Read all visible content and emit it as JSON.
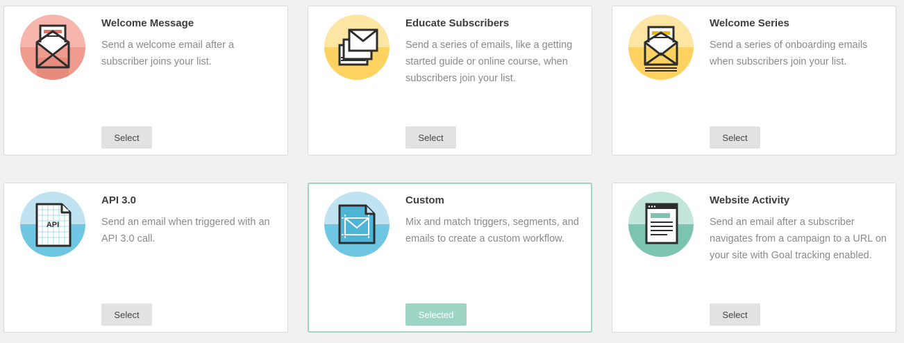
{
  "cards": [
    {
      "title": "Welcome Message",
      "desc": "Send a welcome email after a subscriber joins your list.",
      "button": "Select",
      "icon": "open-envelope-icon",
      "color_top": "#f6b6ad",
      "color_bottom": "#ef9c8f"
    },
    {
      "title": "Educate Subscribers",
      "desc": "Send a series of emails, like a getting started guide or online course, when subscribers join your list.",
      "button": "Select",
      "icon": "stacked-envelopes-icon",
      "color_top": "#fde6a3",
      "color_bottom": "#fdd260"
    },
    {
      "title": "Welcome Series",
      "desc": "Send a series of onboarding emails when subscribers join your list.",
      "button": "Select",
      "icon": "envelope-series-icon",
      "color_top": "#fde6a3",
      "color_bottom": "#fdd260"
    },
    {
      "title": "API 3.0",
      "desc": "Send an email when triggered with an API 3.0 call.",
      "button": "Select",
      "icon": "api-document-icon",
      "color_top": "#bfe3f1",
      "color_bottom": "#6ec6e2"
    },
    {
      "title": "Custom",
      "desc": "Mix and match triggers, segments, and emails to create a custom workflow.",
      "button": "Selected",
      "icon": "custom-blueprint-icon",
      "color_top": "#bfe3f1",
      "color_bottom": "#6ec6e2"
    },
    {
      "title": "Website Activity",
      "desc": "Send an email after a subscriber navigates from a campaign to a URL on your site with Goal tracking enabled.",
      "button": "Select",
      "icon": "browser-window-icon",
      "color_top": "#c3e6dc",
      "color_bottom": "#7cc4b1"
    }
  ]
}
